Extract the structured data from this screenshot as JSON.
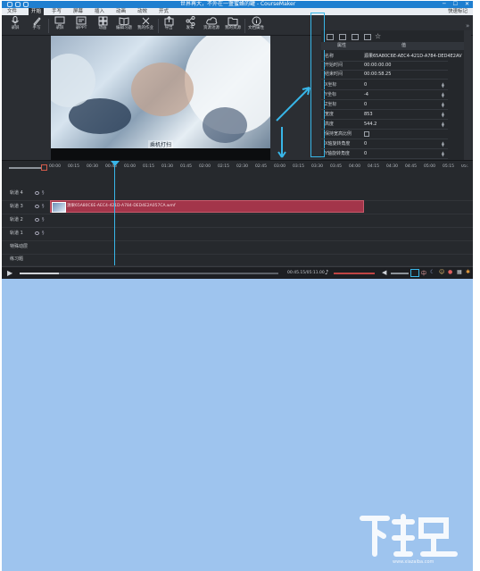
{
  "window": {
    "title": "世界再大，不外在一盏蜜蜂的罐 - CourseMaker",
    "controls": [
      "─",
      "☐",
      "✕"
    ]
  },
  "menubar": {
    "items": [
      "文件",
      "开始",
      "手写",
      "屏幕",
      "插入",
      "动画",
      "动效",
      "开式"
    ],
    "active_index": 1,
    "right_label": "快速标记"
  },
  "ribbon": {
    "buttons": [
      {
        "label": "录屏",
        "icon": "microphone-icon"
      },
      {
        "label": "手写",
        "icon": "pen-icon"
      },
      {
        "label": "录屏",
        "icon": "monitor-icon"
      },
      {
        "label": "录PPT",
        "icon": "ppt-icon"
      },
      {
        "label": "动画",
        "icon": "grid-icon"
      },
      {
        "label": "编辑习题",
        "icon": "book-icon"
      },
      {
        "label": "我的作业",
        "icon": "tools-icon"
      },
      {
        "label": "导出",
        "icon": "export-icon"
      },
      {
        "label": "发布",
        "icon": "share-icon"
      },
      {
        "label": "资源池源",
        "icon": "cloud-icon"
      },
      {
        "label": "我的资源",
        "icon": "folder-icon"
      },
      {
        "label": "文档属性",
        "icon": "info-icon"
      }
    ]
  },
  "preview": {
    "caption": "乘机打扫"
  },
  "properties": {
    "header": {
      "key": "属性",
      "value": "值"
    },
    "rows": [
      {
        "key": "名称",
        "value": "源果65A80C6E-AEC4-421D-A784-DED4E2AV",
        "type": "text"
      },
      {
        "key": "开始时间",
        "value": "00:00:00.00",
        "type": "text"
      },
      {
        "key": "结束时间",
        "value": "00:00:58.25",
        "type": "text"
      },
      {
        "key": "X坐标",
        "value": "0",
        "type": "spin"
      },
      {
        "key": "Y坐标",
        "value": "-4",
        "type": "spin"
      },
      {
        "key": "Z坐标",
        "value": "0",
        "type": "spin"
      },
      {
        "key": "宽度",
        "value": "853",
        "type": "spin"
      },
      {
        "key": "高度",
        "value": "544.2",
        "type": "spin"
      },
      {
        "key": "保持宽高比例",
        "value": "",
        "type": "check"
      },
      {
        "key": "X轴旋转角度",
        "value": "0",
        "type": "spin"
      },
      {
        "key": "Y轴旋转角度",
        "value": "0",
        "type": "spin"
      }
    ]
  },
  "timeline": {
    "ticks": [
      "00:00",
      "00:15",
      "00:30",
      "00:45",
      "01:00",
      "01:15",
      "01:30",
      "01:45",
      "02:00",
      "02:15",
      "02:30",
      "02:45",
      "03:00",
      "03:15",
      "03:30",
      "03:45",
      "04:00",
      "04:15",
      "04:30",
      "04:45",
      "05:00",
      "05:15",
      "05:30"
    ],
    "tracks": [
      "轨道 4",
      "轨道 3",
      "轨道 2",
      "轨道 1",
      "特殊动层",
      "练习题"
    ],
    "clip_label": "源果65A80C6E-AEC4-421D-A784-DED4E2A057CA.wmf"
  },
  "transport": {
    "time": "00:45.15/05:11.00"
  },
  "watermark": {
    "logo_text": "下载吧",
    "url": "www.xiazaiba.com"
  },
  "colors": {
    "app_bg": "#2b2e33",
    "title_blue": "#1f7fd0",
    "clip_red": "#a3354a",
    "playhead": "#38b6e8",
    "page_blue": "#9ec4ee"
  }
}
